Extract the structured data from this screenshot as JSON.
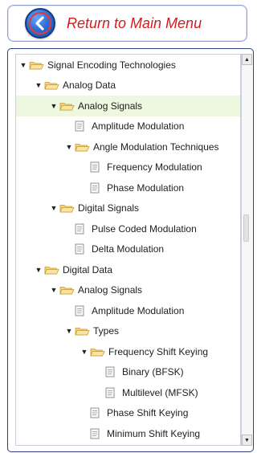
{
  "header": {
    "return_label": "Return to Main Menu",
    "back_icon": "back-arrow-icon",
    "accent_color": "#d31b1b"
  },
  "tree": {
    "toggle_icon": "▼",
    "nodes": [
      {
        "label": "Signal Encoding Technologies",
        "type": "folder",
        "expanded": true,
        "level": 0
      },
      {
        "label": "Analog Data",
        "type": "folder",
        "expanded": true,
        "level": 1
      },
      {
        "label": "Analog Signals",
        "type": "folder",
        "expanded": true,
        "level": 2,
        "highlighted": true
      },
      {
        "label": "Amplitude Modulation",
        "type": "doc",
        "level": 3
      },
      {
        "label": "Angle Modulation Techniques",
        "type": "folder",
        "expanded": true,
        "level": 3
      },
      {
        "label": "Frequency Modulation",
        "type": "doc",
        "level": 4
      },
      {
        "label": "Phase Modulation",
        "type": "doc",
        "level": 4
      },
      {
        "label": "Digital Signals",
        "type": "folder",
        "expanded": true,
        "level": 2
      },
      {
        "label": "Pulse Coded Modulation",
        "type": "doc",
        "level": 3
      },
      {
        "label": "Delta Modulation",
        "type": "doc",
        "level": 3
      },
      {
        "label": "Digital Data",
        "type": "folder",
        "expanded": true,
        "level": 1
      },
      {
        "label": "Analog Signals",
        "type": "folder",
        "expanded": true,
        "level": 2
      },
      {
        "label": "Amplitude Modulation",
        "type": "doc",
        "level": 3
      },
      {
        "label": "Types",
        "type": "folder",
        "expanded": true,
        "level": 3
      },
      {
        "label": "Frequency Shift Keying",
        "type": "folder",
        "expanded": true,
        "level": 4
      },
      {
        "label": "Binary (BFSK)",
        "type": "doc",
        "level": 5
      },
      {
        "label": "Multilevel (MFSK)",
        "type": "doc",
        "level": 5
      },
      {
        "label": "Phase Shift Keying",
        "type": "doc",
        "level": 4
      },
      {
        "label": "Minimum Shift Keying",
        "type": "doc",
        "level": 4
      }
    ]
  },
  "scrollbar": {
    "up_icon": "▲",
    "down_icon": "▼"
  }
}
